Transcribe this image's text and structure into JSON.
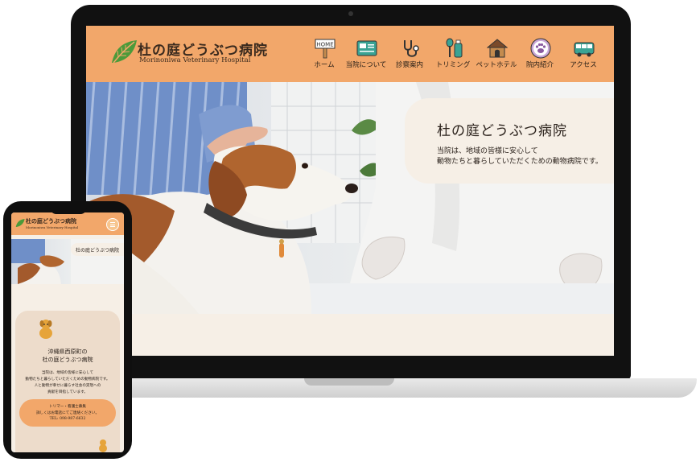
{
  "desktop": {
    "logo": {
      "title": "杜の庭どうぶつ病院",
      "subtitle": "Morinoniwa Veterinary Hospital"
    },
    "nav": [
      {
        "label": "ホーム",
        "icon": "home-sign-icon"
      },
      {
        "label": "当院について",
        "icon": "hospital-board-icon"
      },
      {
        "label": "診察案内",
        "icon": "stethoscope-icon"
      },
      {
        "label": "トリミング",
        "icon": "grooming-icon"
      },
      {
        "label": "ペットホテル",
        "icon": "dog-house-icon"
      },
      {
        "label": "院内紹介",
        "icon": "paw-icon"
      },
      {
        "label": "アクセス",
        "icon": "bus-icon"
      }
    ],
    "hero": {
      "title": "杜の庭どうぶつ病院",
      "line1": "当院は、地域の皆様に安心して",
      "line2": "動物たちと暮らしていただくための動物病院です。"
    }
  },
  "mobile": {
    "logo": {
      "title": "杜の庭どうぶつ病院",
      "subtitle": "Morinoniwa Veterinary Hospital"
    },
    "hero_title": "杜の庭どうぶつ病院",
    "heading_line1": "沖縄県西原町の",
    "heading_line2": "杜の庭どうぶつ病院",
    "body": [
      "当院は、地域の皆様に安心して",
      "動物たちと暮らしていただくための動物病院です。",
      "人と動物が幸せに暮らす社会の実現への",
      "貢献を目指しています。"
    ],
    "pill": [
      "トリマー・看護士募集",
      "詳しくはお電話にてご連絡ください。",
      "TEL: 098-987-6632"
    ]
  },
  "colors": {
    "header": "#f2a76a",
    "background": "#f6efe6",
    "leaf": "#4c9a3a"
  }
}
